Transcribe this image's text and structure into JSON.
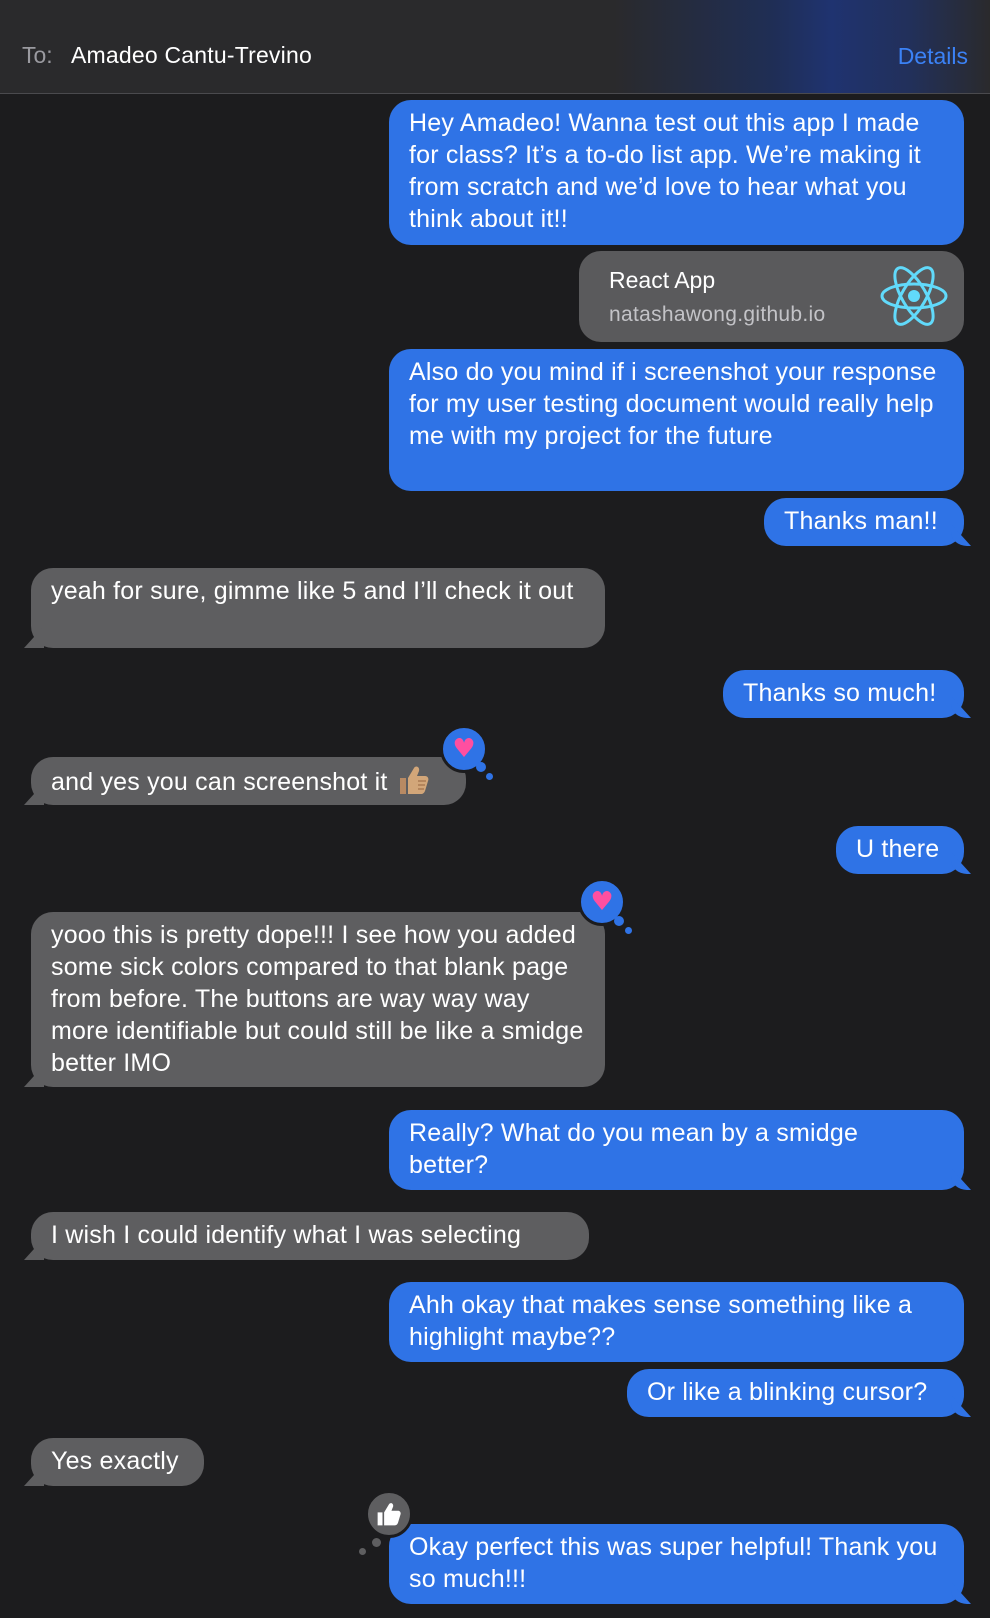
{
  "header": {
    "to_label": "To:",
    "recipient": "Amadeo Cantu-Trevino",
    "details_label": "Details"
  },
  "messages": [
    {
      "from": "me",
      "text": "Hey Amadeo! Wanna test out this app I made for class? It’s a to-do list app. We’re making it from scratch and we’d love to hear what you think about it!!"
    },
    {
      "from": "me",
      "type": "link",
      "title": "React App",
      "domain": "natashawong.github.io",
      "icon": "react-logo-icon"
    },
    {
      "from": "me",
      "text": "Also do you mind if i screenshot your response for my user testing document would really help me with my project for the future"
    },
    {
      "from": "me",
      "text": "Thanks man!!"
    },
    {
      "from": "them",
      "text": "yeah for sure, gimme like 5 and I’ll check it out"
    },
    {
      "from": "me",
      "text": "Thanks so much!"
    },
    {
      "from": "them",
      "text": "and yes you can screenshot it",
      "emoji": "thumbs-up-icon",
      "reaction": "heart"
    },
    {
      "from": "me",
      "text": "U there"
    },
    {
      "from": "them",
      "text": "yooo this is pretty dope!!! I see how you added some sick colors compared to that blank page from before. The buttons are way way way more identifiable but could still be like a smidge better IMO",
      "reaction": "heart"
    },
    {
      "from": "me",
      "text": "Really? What do you mean by a smidge better?"
    },
    {
      "from": "them",
      "text": "I wish I could identify what I was selecting"
    },
    {
      "from": "me",
      "text": "Ahh okay that makes sense something like a highlight maybe??"
    },
    {
      "from": "me",
      "text": "Or like a blinking cursor?"
    },
    {
      "from": "them",
      "text": "Yes exactly"
    },
    {
      "from": "me",
      "text": "Okay perfect this was super helpful! Thank you so much!!!",
      "reaction": "thumbs-up"
    }
  ],
  "colors": {
    "background": "#1c1c1e",
    "outgoing_bubble": "#2f73e6",
    "incoming_bubble": "#5e5e60",
    "details_link": "#3b82f6",
    "heart": "#ff4fa0",
    "react_logo": "#61dafb"
  }
}
